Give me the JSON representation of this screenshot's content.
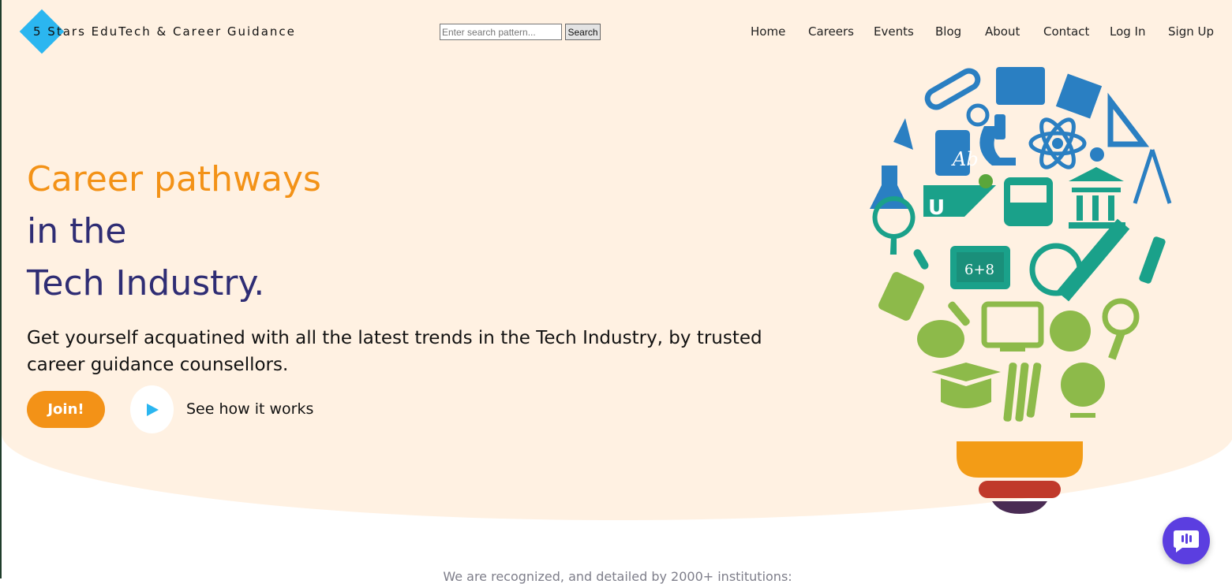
{
  "header": {
    "brand": "5 Stars EduTech & Career Guidance",
    "search_placeholder": "Enter search pattern...",
    "search_button": "Search",
    "nav": [
      "Home",
      "Careers",
      "Events",
      "Blog",
      "About",
      "Contact",
      "Log In",
      "Sign Up"
    ]
  },
  "hero": {
    "line1": "Career pathways",
    "line2": "in the",
    "line3": "Tech Industry.",
    "subtitle": "Get yourself acquatined with all the latest trends in the Tech Industry, by trusted career guidance counsellors.",
    "join_button": "Join!",
    "how_link": "See how it works",
    "illustration_text": [
      "Ab",
      "U",
      "6+8"
    ]
  },
  "section": {
    "recognized": "We are recognized, and detailed by 2000+ institutions:"
  },
  "colors": {
    "accent_orange": "#f39217",
    "heading_navy": "#2f2d74",
    "hero_bg": "#fff1e2",
    "logo_blue": "#2bb6f0",
    "chat_purple": "#5b3ee0"
  },
  "icons": [
    "logo-diamond-icon",
    "play-icon",
    "chat-icon",
    "education-lightbulb-illustration"
  ]
}
